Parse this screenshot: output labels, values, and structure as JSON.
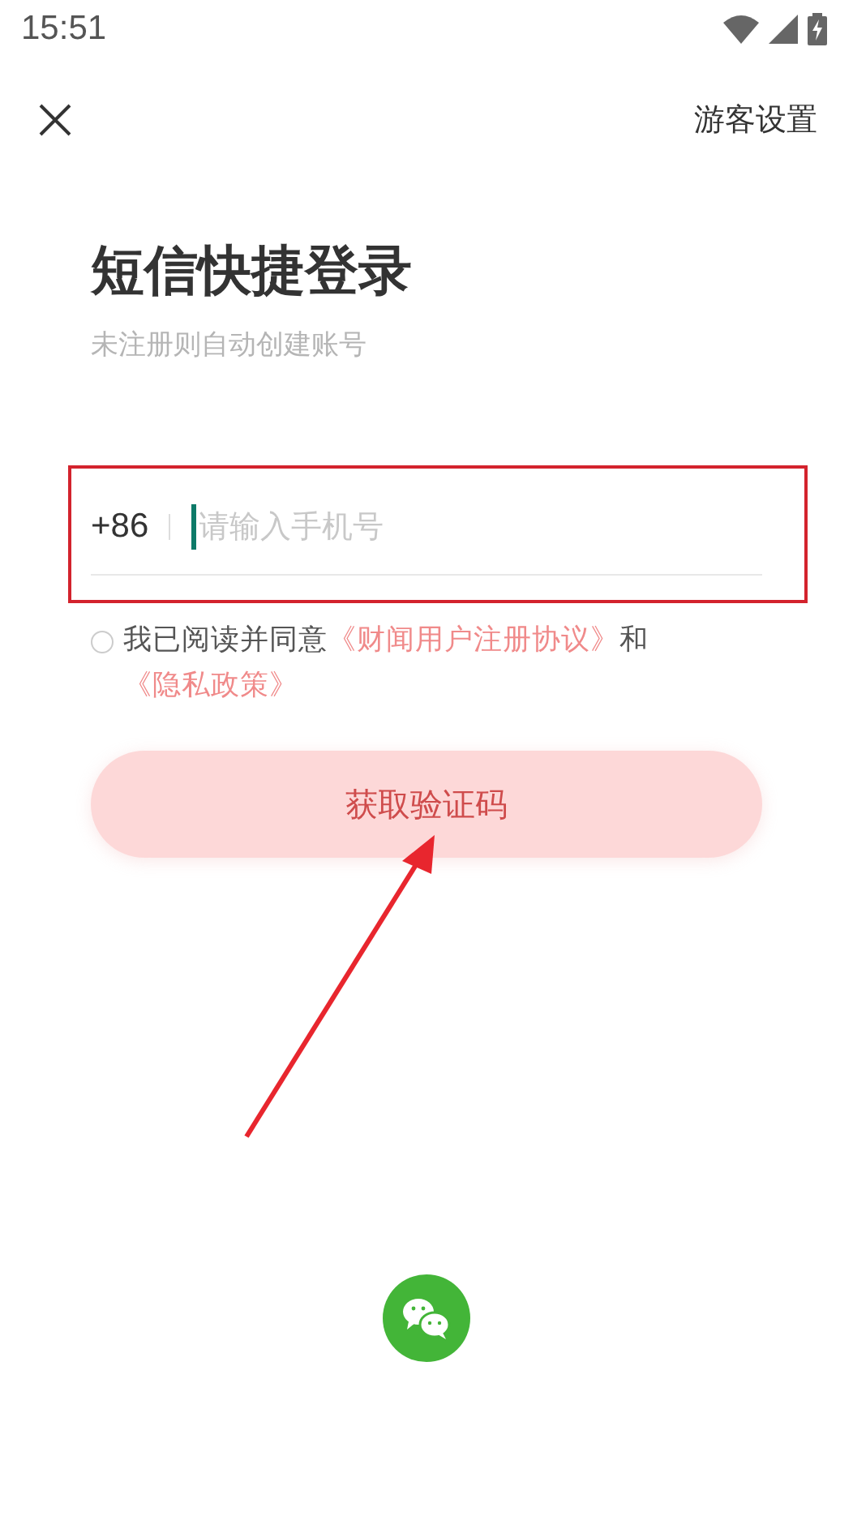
{
  "status_bar": {
    "time": "15:51"
  },
  "header": {
    "guest_settings": "游客设置"
  },
  "title": "短信快捷登录",
  "subtitle": "未注册则自动创建账号",
  "phone_field": {
    "country_code": "+86",
    "placeholder": "请输入手机号",
    "focused": true
  },
  "agreement": {
    "checked": false,
    "parts": [
      {
        "kind": "text",
        "text": "我已阅读并同意"
      },
      {
        "kind": "link",
        "text": "《财闻用户注册协议》"
      },
      {
        "kind": "text",
        "text": "和"
      },
      {
        "kind": "link",
        "text": "《隐私政策》"
      }
    ]
  },
  "submit_button": {
    "label": "获取验证码",
    "disabled": true
  }
}
